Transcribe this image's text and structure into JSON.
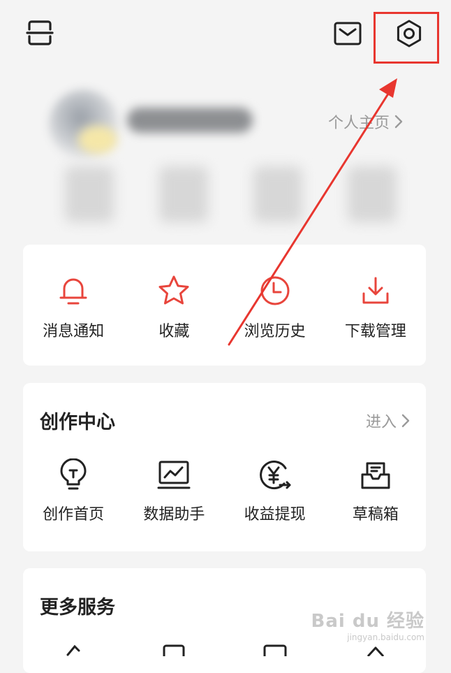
{
  "header": {
    "scan_icon": "scan-icon",
    "mail_icon": "mail-icon",
    "settings_icon": "gear-icon"
  },
  "profile": {
    "homepage_label": "个人主页"
  },
  "quick_actions": [
    {
      "label": "消息通知",
      "icon": "bell-icon"
    },
    {
      "label": "收藏",
      "icon": "star-icon"
    },
    {
      "label": "浏览历史",
      "icon": "clock-icon"
    },
    {
      "label": "下载管理",
      "icon": "download-icon"
    }
  ],
  "creator_center": {
    "title": "创作中心",
    "enter_label": "进入",
    "items": [
      {
        "label": "创作首页",
        "icon": "lightbulb-icon"
      },
      {
        "label": "数据助手",
        "icon": "chart-monitor-icon"
      },
      {
        "label": "收益提现",
        "icon": "yuan-withdraw-icon"
      },
      {
        "label": "草稿箱",
        "icon": "draft-box-icon"
      }
    ]
  },
  "more_services": {
    "title": "更多服务"
  },
  "watermark": {
    "main": "Bai du 经验",
    "sub": "jingyan.baidu.com"
  },
  "colors": {
    "accent_red": "#e8453c",
    "annotation_red": "#e8362f",
    "background": "#f4f4f4",
    "muted_text": "#9a9a9a"
  }
}
